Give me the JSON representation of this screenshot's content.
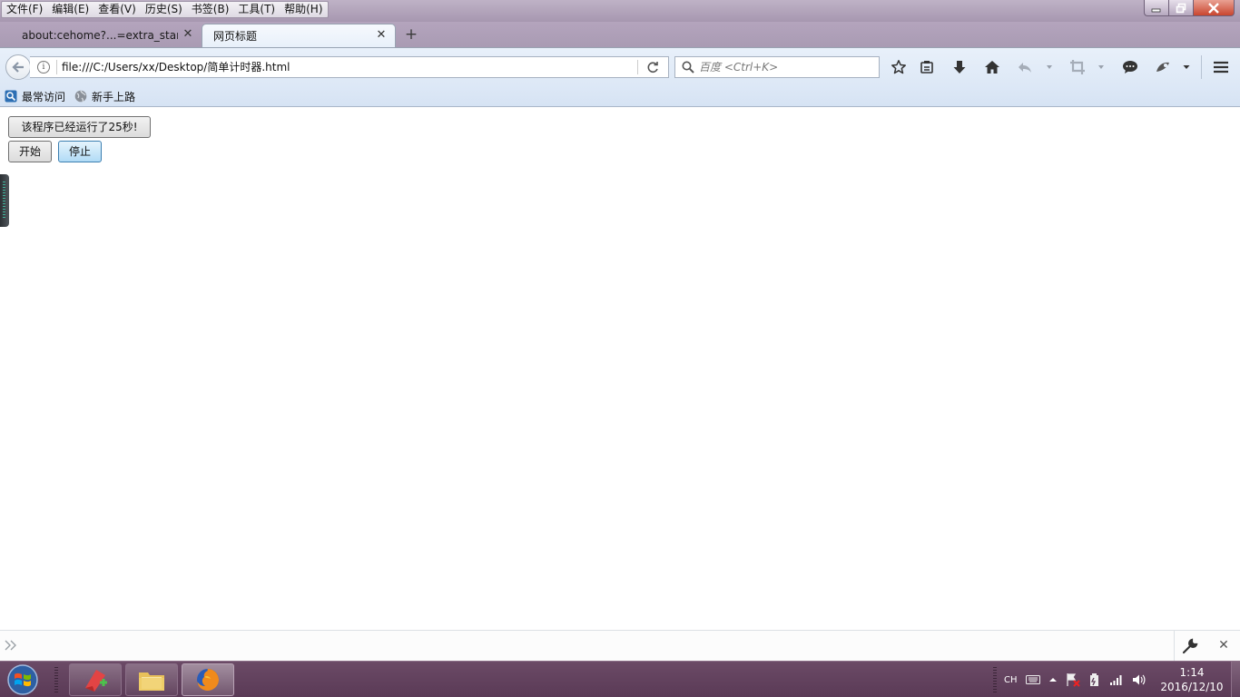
{
  "menubar": {
    "items": [
      "文件(F)",
      "编辑(E)",
      "查看(V)",
      "历史(S)",
      "书签(B)",
      "工具(T)",
      "帮助(H)"
    ]
  },
  "tabs": [
    {
      "label": "about:cehome?...=extra_start",
      "active": false
    },
    {
      "label": "网页标题",
      "active": true
    }
  ],
  "navbar": {
    "url": "file:///C:/Users/xx/Desktop/简单计时器.html",
    "search_placeholder": "百度 <Ctrl+K>"
  },
  "bookmarks": [
    "最常访问",
    "新手上路"
  ],
  "page": {
    "status_text": "该程序已经运行了25秒!",
    "start_label": "开始",
    "stop_label": "停止"
  },
  "taskbar": {
    "ime": "CH",
    "time": "1:14",
    "date": "2016/12/10"
  },
  "colors": {
    "titlebar": "#a797b0",
    "navbar": "#dde8f6",
    "taskbar": "#5a3a56",
    "active_button": "#b1dbf6"
  }
}
